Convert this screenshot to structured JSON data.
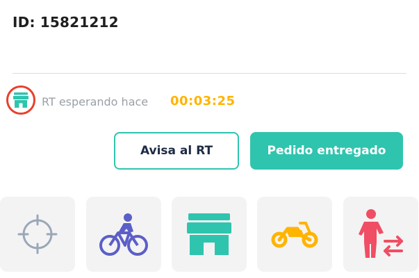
{
  "order": {
    "id_label": "ID: 15821212"
  },
  "status": {
    "icon": "store-icon",
    "text": "RT esperando hace",
    "timer": "00:03:25"
  },
  "actions": {
    "notify_label": "Avisa al RT",
    "delivered_label": "Pedido entregado"
  },
  "tiles": [
    {
      "icon": "crosshair-icon"
    },
    {
      "icon": "bicycle-icon"
    },
    {
      "icon": "store-icon"
    },
    {
      "icon": "motorcycle-icon"
    },
    {
      "icon": "person-transfer-icon"
    }
  ],
  "colors": {
    "accent": "#2fc4ae",
    "timer": "#ffb400",
    "highlight": "#e8402d",
    "bicycle": "#5b5fc7",
    "motorcycle": "#ffb400",
    "transfer": "#f04e64",
    "crosshair": "#9aa7b8"
  }
}
